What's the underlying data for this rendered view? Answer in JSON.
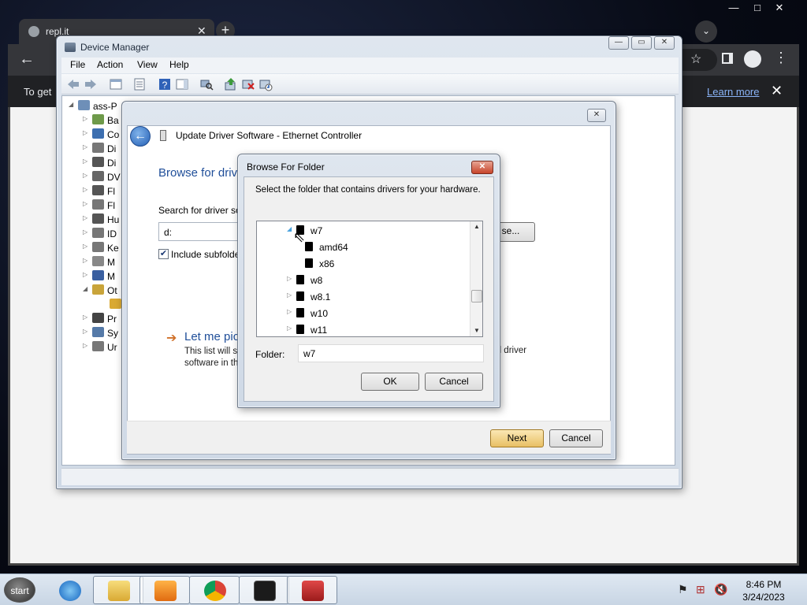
{
  "chrome": {
    "tab_title": "repl.it",
    "infobar_message": "To get",
    "infobar_link": "Learn more"
  },
  "device_manager": {
    "title": "Device Manager",
    "menu": [
      "File",
      "Action",
      "View",
      "Help"
    ],
    "tree": {
      "root": "ass-P",
      "items": [
        "Ba",
        "Co",
        "Di",
        "Di",
        "DV",
        "Fl",
        "Fl",
        "Hu",
        "ID",
        "Ke",
        "M",
        "M",
        "Ot",
        "",
        "Pr",
        "Sy",
        "Ur"
      ]
    }
  },
  "update_driver": {
    "title": "Update Driver Software - Ethernet Controller",
    "heading": "Browse for driv",
    "search_label": "Search for driver so",
    "path_value": "d:",
    "browse_label": "se...",
    "include_subfolders": "Include subfolde",
    "let_me_pick": "Let me pic",
    "let_me_desc_1": "This list will s",
    "let_me_desc_2": "software in th",
    "let_me_desc_tail": "ll driver",
    "next": "Next",
    "cancel": "Cancel"
  },
  "browse_folder": {
    "title": "Browse For Folder",
    "prompt": "Select the folder that contains drivers for your hardware.",
    "folders": [
      {
        "name": "w7",
        "level": 0,
        "expanded": true
      },
      {
        "name": "amd64",
        "level": 1,
        "expanded": false
      },
      {
        "name": "x86",
        "level": 1,
        "expanded": false
      },
      {
        "name": "w8",
        "level": 0,
        "expanded": false
      },
      {
        "name": "w8.1",
        "level": 0,
        "expanded": false
      },
      {
        "name": "w10",
        "level": 0,
        "expanded": false
      },
      {
        "name": "w11",
        "level": 0,
        "expanded": false
      }
    ],
    "folder_label": "Folder:",
    "folder_value": "w7",
    "ok": "OK",
    "cancel": "Cancel"
  },
  "taskbar": {
    "start_label": "start",
    "apps": [
      "internet-explorer",
      "file-explorer",
      "media-player",
      "chrome",
      "terminal",
      "toolbox"
    ],
    "time": "8:46 PM",
    "date": "3/24/2023"
  }
}
